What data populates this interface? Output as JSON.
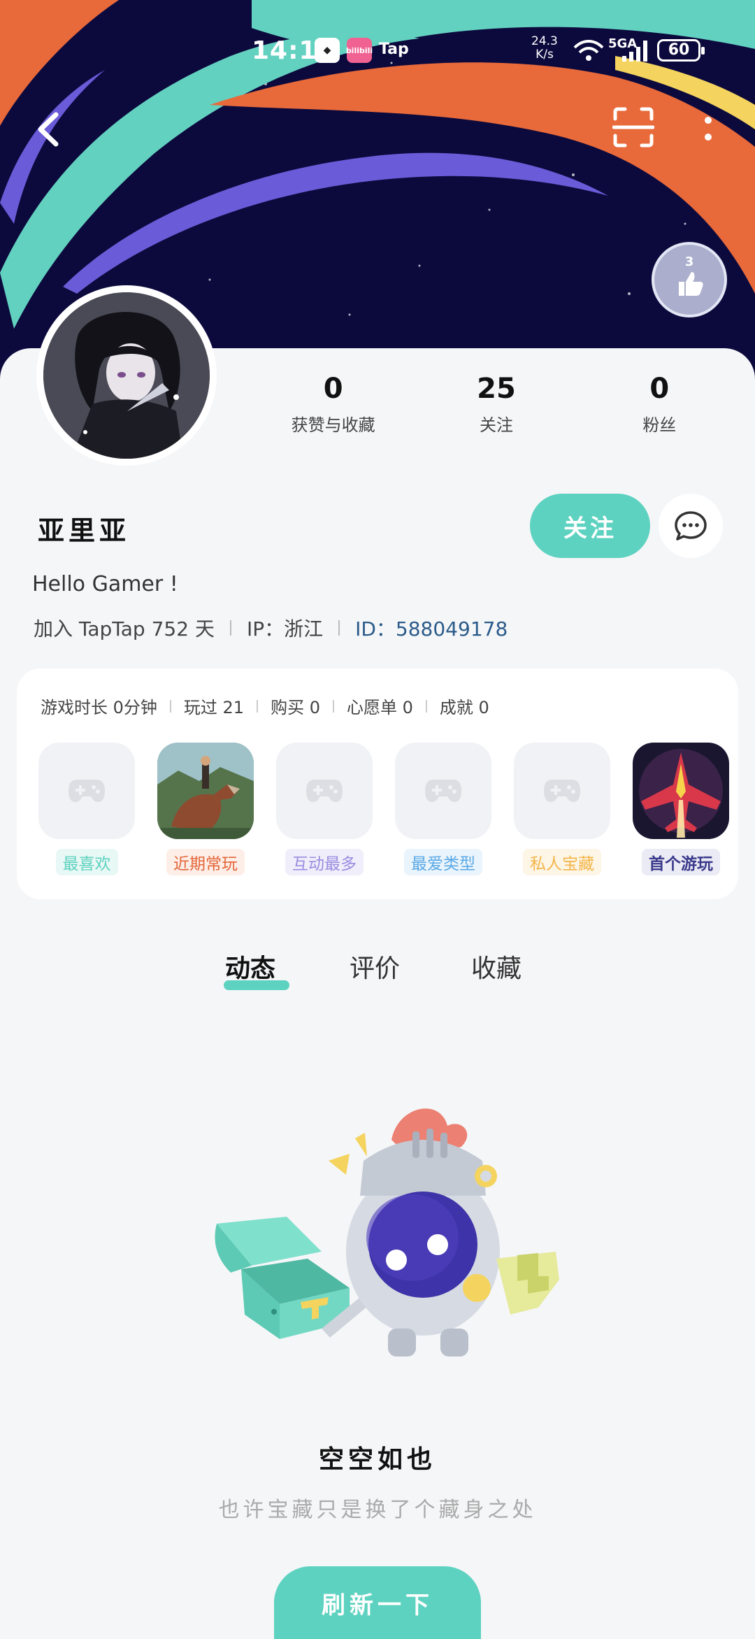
{
  "status_bar": {
    "time": "14:11",
    "app_icons": [
      "bilibili"
    ],
    "tap_label": "Tap",
    "speed_value": "24.3",
    "speed_unit": "K/s",
    "network": "5GA",
    "battery": "60"
  },
  "profile": {
    "badge_level": "3",
    "stats": [
      {
        "value": "0",
        "label": "获赞与收藏"
      },
      {
        "value": "25",
        "label": "关注"
      },
      {
        "value": "0",
        "label": "粉丝"
      }
    ],
    "username": "亚里亚",
    "follow_label": "关注",
    "bio": "Hello Gamer !",
    "joined": "加入 TapTap 752 天",
    "ip": "IP：浙江",
    "id": "ID：588049178"
  },
  "game_stats": [
    "游戏时长 0分钟",
    "玩过 21",
    "购买 0",
    "心愿单 0",
    "成就 0"
  ],
  "games": [
    {
      "tag": "最喜欢",
      "color": "#5ed2c0",
      "bg": "#e8f8f5",
      "icon": "gamepad-icon"
    },
    {
      "tag": "近期常玩",
      "color": "#e4663a",
      "bg": "#fdeee7",
      "icon": "dinosaur-game-art"
    },
    {
      "tag": "互动最多",
      "color": "#9a8de0",
      "bg": "#f0eefb",
      "icon": "gamepad-icon"
    },
    {
      "tag": "最爱类型",
      "color": "#5ba9e6",
      "bg": "#eaf4fc",
      "icon": "gamepad-icon"
    },
    {
      "tag": "私人宝藏",
      "color": "#f3b64a",
      "bg": "#fdf5e6",
      "icon": "gamepad-icon"
    },
    {
      "tag": "首个游玩",
      "color": "#3b3a8c",
      "bg": "#ebebf5",
      "icon": "jet-fighter-game-art"
    }
  ],
  "tabs": [
    "动态",
    "评价",
    "收藏"
  ],
  "empty": {
    "title": "空空如也",
    "subtitle": "也许宝藏只是换了个藏身之处",
    "refresh_label": "刷新一下"
  },
  "colors": {
    "accent": "#5ed2c0",
    "banner_bg": "#0c0a3d",
    "id_text": "#2b5b8a"
  }
}
